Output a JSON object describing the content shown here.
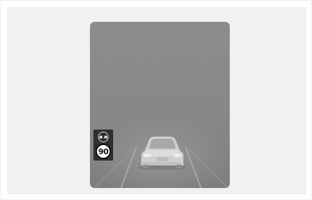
{
  "display": {
    "speed_limit_value": "90",
    "overtaking_sign_icon": "no-overtaking-icon",
    "lead_vehicle_icon": "car-rear-icon"
  },
  "colors": {
    "screen": "#8a8a8a",
    "sign_panel": "#2f2f2f",
    "speed_sign_face": "#ffffff",
    "speed_sign_border": "#111111"
  }
}
